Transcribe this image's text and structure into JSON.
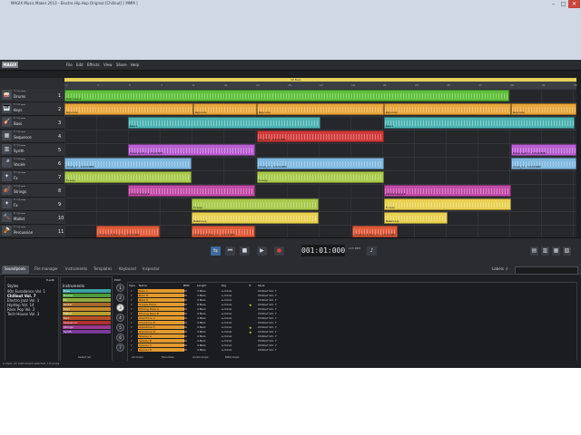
{
  "window": {
    "title": "MAGIX Music Maker 2013 - Electro Hip Hop Original [Chillout]  [ MMM ]"
  },
  "menu": {
    "logo": "MAGIX",
    "items": [
      "File",
      "Edit",
      "Effects",
      "View",
      "Share",
      "Help"
    ]
  },
  "ruler": {
    "loop_label": "32 Bars",
    "numbers": [
      "1",
      "3",
      "5",
      "7",
      "9",
      "11",
      "13",
      "15",
      "17",
      "19",
      "21",
      "23",
      "25",
      "27",
      "29",
      "31",
      "33"
    ]
  },
  "tracks": [
    {
      "name": "Drums",
      "num": "1",
      "icon": "🥁"
    },
    {
      "name": "Keys",
      "num": "2",
      "icon": "🎹"
    },
    {
      "name": "Bass",
      "num": "3",
      "icon": "🎸"
    },
    {
      "name": "Sequence",
      "num": "4",
      "icon": "▦"
    },
    {
      "name": "Synth",
      "num": "5",
      "icon": "▥"
    },
    {
      "name": "Vocals",
      "num": "6",
      "icon": "🎤"
    },
    {
      "name": "Fx",
      "num": "7",
      "icon": "✦"
    },
    {
      "name": "Strings",
      "num": "8",
      "icon": "🎻"
    },
    {
      "name": "Fx",
      "num": "9",
      "icon": "✦"
    },
    {
      "name": "Mallet",
      "num": "10",
      "icon": "🔨"
    },
    {
      "name": "Percussion",
      "num": "11",
      "icon": "🪘"
    }
  ],
  "colors": {
    "drums": "#5fbf3a",
    "keys": "#e8a63a",
    "bass": "#4db3b3",
    "sequence": "#d13a3a",
    "synth": "#b95fd1",
    "vocals": "#7fb8e0",
    "fx": "#a8c94a",
    "strings": "#c24ba8",
    "fx2": "#e8d050",
    "mallet": "#e8d050",
    "perc": "#e05a3a"
  },
  "clip_labels": {
    "drums": "Drum Loop 1",
    "keys": "Keys Loop",
    "bass": "Bass 1",
    "sequence": "Seq_Vol.2 - 115.00 BPM",
    "synth": "Stereo Synth A  · 115.00 BPM",
    "vocals": "Vocals_4 A  · 115.00 BPM",
    "fx": "Fx Loop",
    "strings": "Chillout Strings B",
    "mallet": "Mallet Loop",
    "perc": "Combined_B_Bass_4 A - 115.00 BPM"
  },
  "transport": {
    "time": "001:01:000",
    "bpm": "115 BPM",
    "tempo_label": "Bar"
  },
  "browser": {
    "tabs": [
      "Soundpools",
      "File manager",
      "Instruments",
      "Templates",
      "Keyboard",
      "Inspector"
    ],
    "labels_label": "Labels",
    "styles_header": "Styles",
    "styles_edit": "E-edit",
    "styles": [
      "90s Eurodance Vol. 1",
      "Chillout Vol. 7",
      "Electro Jazz Vol. 1",
      "HipHop Vol. 14",
      "Rock Pop Vol. 2",
      "Tech-House Vol. 3"
    ],
    "styles_selected": 1,
    "instruments_header": "Instruments",
    "instruments": [
      "Bass",
      "Drums",
      "Fx",
      "Guitar",
      "Keys",
      "Mallet",
      "Perc",
      "Sequence",
      "Strings",
      "Synth"
    ],
    "instr_colors": [
      "#3aa0a0",
      "#4f9a3a",
      "#8fae3a",
      "#a86a2a",
      "#c88a2a",
      "#b8a030",
      "#b8502a",
      "#b03030",
      "#9a3a8a",
      "#7a3a9a"
    ],
    "select_all": "Select all",
    "pitch_header": "Pitch",
    "pitch": [
      "1",
      "2",
      "3",
      "4",
      "5",
      "6",
      "7"
    ],
    "pitch_selected": 2,
    "columns": [
      "Type",
      "Name",
      "BPM",
      "Length",
      "Key",
      "★",
      "Style"
    ],
    "loops": [
      {
        "name": "Bass A",
        "bpm": "90",
        "length": "4 Bars",
        "key": "e-minor",
        "star": "",
        "style": "Chillout Vol. 7"
      },
      {
        "name": "Bass B",
        "bpm": "90",
        "length": "4 Bars",
        "key": "e-minor",
        "star": "",
        "style": "Chillout Vol. 7"
      },
      {
        "name": "Bass C",
        "bpm": "90",
        "length": "4 Bars",
        "key": "e-minor",
        "star": "",
        "style": "Chillout Vol. 7"
      },
      {
        "name": "Simple Piano",
        "bpm": "90",
        "length": "8 Bars",
        "key": "e-minor",
        "star": "★",
        "style": "Chillout Vol. 7"
      },
      {
        "name": "Moving Keys A",
        "bpm": "90",
        "length": "4 Bars",
        "key": "e-minor",
        "star": "",
        "style": "Chillout Vol. 7"
      },
      {
        "name": "Moving Keys B",
        "bpm": "90",
        "length": "4 Bars",
        "key": "e-minor",
        "star": "",
        "style": "Chillout Vol. 7"
      },
      {
        "name": "Overdrive A",
        "bpm": "90",
        "length": "4 Bars",
        "key": "e-minor",
        "star": "",
        "style": "Chillout Vol. 7"
      },
      {
        "name": "Overdrive B",
        "bpm": "90",
        "length": "4 Bars",
        "key": "e-minor",
        "star": "",
        "style": "Chillout Vol. 7"
      },
      {
        "name": "Overdrive C",
        "bpm": "90",
        "length": "4 Bars",
        "key": "e-minor",
        "star": "★",
        "style": "Chillout Vol. 7"
      },
      {
        "name": "Overdrive D",
        "bpm": "90",
        "length": "4 Bars",
        "key": "e-minor",
        "star": "★",
        "style": "Chillout Vol. 7"
      },
      {
        "name": "Spacey A",
        "bpm": "90",
        "length": "4 Bars",
        "key": "e-minor",
        "star": "",
        "style": "Chillout Vol. 7"
      },
      {
        "name": "Spacey B",
        "bpm": "90",
        "length": "4 Bars",
        "key": "e-minor",
        "star": "",
        "style": "Chillout Vol. 7"
      },
      {
        "name": "Spacey C",
        "bpm": "90",
        "length": "4 Bars",
        "key": "e-minor",
        "star": "",
        "style": "Chillout Vol. 7"
      },
      {
        "name": "Spacey D",
        "bpm": "90",
        "length": "4 Bars",
        "key": "e-minor",
        "star": "",
        "style": "Chillout Vol. 7"
      }
    ],
    "filters": [
      "All loops",
      "Favorites",
      "Audio loops",
      "MIDI loops"
    ],
    "status": "A style, an instrument selected, 14 Loops"
  }
}
